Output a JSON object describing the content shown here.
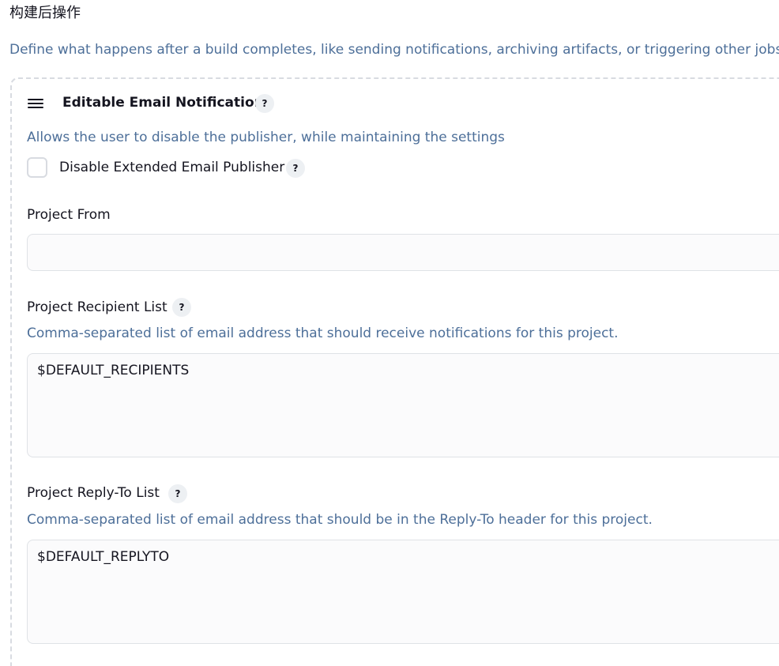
{
  "section": {
    "title": "构建后操作",
    "description": "Define what happens after a build completes, like sending notifications, archiving artifacts, or triggering other jobs."
  },
  "publisher": {
    "title": "Editable Email Notification",
    "help": "?",
    "disable_description": "Allows the user to disable the publisher, while maintaining the settings",
    "disable_label": "Disable Extended Email Publisher",
    "disable_help": "?",
    "disable_checked": false
  },
  "fields": {
    "project_from": {
      "label": "Project From",
      "value": ""
    },
    "recipient_list": {
      "label": "Project Recipient List",
      "help": "?",
      "description": "Comma-separated list of email address that should receive notifications for this project.",
      "value": "$DEFAULT_RECIPIENTS"
    },
    "reply_to_list": {
      "label": "Project Reply-To List",
      "help": "?",
      "description": "Comma-separated list of email address that should be in the Reply-To header for this project.",
      "value": "$DEFAULT_REPLYTO"
    }
  },
  "icons": {
    "drag": "drag-handle-icon",
    "help": "help-icon"
  },
  "colors": {
    "description_text": "#4d6f99",
    "primary_text": "#14141f",
    "border": "#d8dbe1",
    "input_background": "#fbfbfc",
    "help_background": "#edf0f3"
  }
}
